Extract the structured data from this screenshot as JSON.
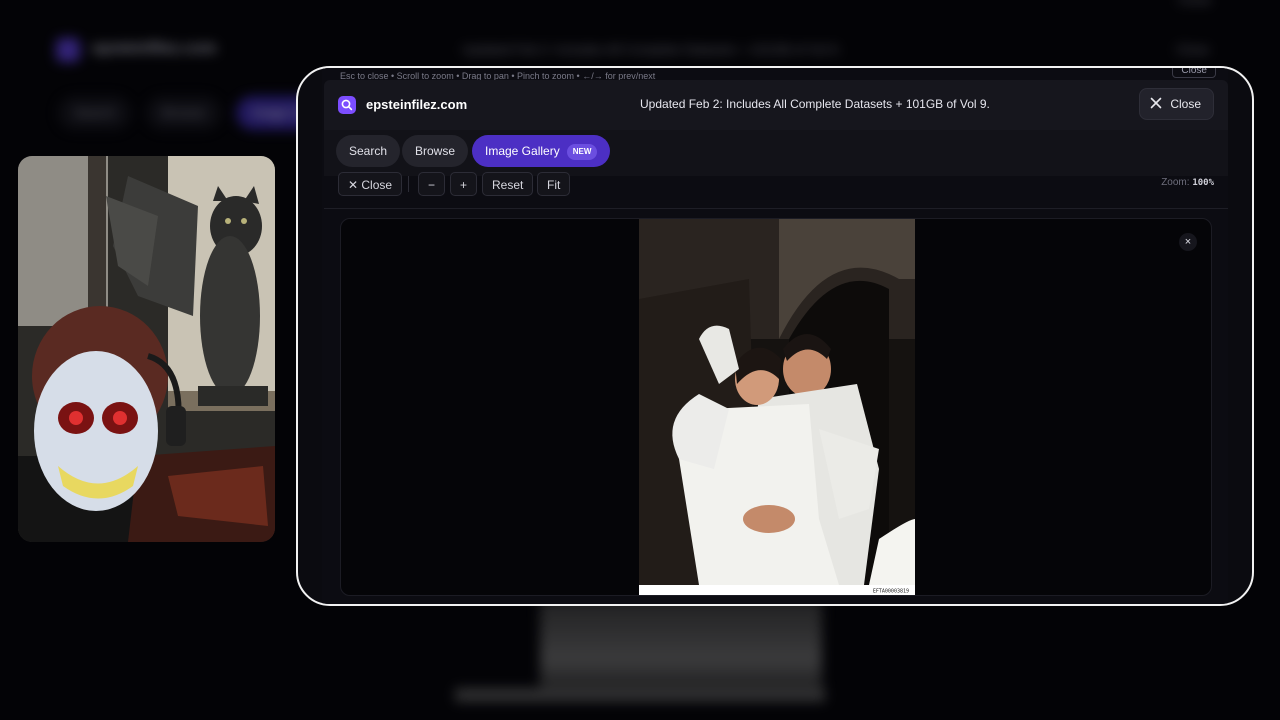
{
  "background": {
    "site_name": "epsteinfilez.com",
    "banner": "Updated Feb 2: Includes All Complete Datasets + 101GB of Vol 9.",
    "close_label": "Close",
    "tabs": [
      "Search",
      "Browse",
      "Image Gallery"
    ]
  },
  "modal": {
    "hint": "Esc to close • Scroll to zoom • Drag to pan • Pinch to zoom • ←/→ for prev/next",
    "hint_close_label": "Close",
    "header": {
      "site_name": "epsteinfilez.com",
      "banner": "Updated Feb 2: Includes All Complete Datasets + 101GB of Vol 9.",
      "close_label": "Close"
    },
    "tabs": [
      {
        "label": "Search",
        "active": false
      },
      {
        "label": "Browse",
        "active": false
      },
      {
        "label": "Image Gallery",
        "active": true,
        "badge": "NEW"
      }
    ],
    "toolbar": {
      "close_label": "✕ Close",
      "zoom_out_label": "−",
      "zoom_in_label": "+",
      "reset_label": "Reset",
      "fit_label": "Fit",
      "zoom_label": "Zoom:",
      "zoom_value": "100%"
    },
    "viewer": {
      "close_glyph": "×",
      "image_caption": "EFTA00003819"
    }
  },
  "colors": {
    "accent": "#4c2fc4",
    "logo": "#7c4dff",
    "frame_border": "#f2f2f2"
  },
  "icons": {
    "logo": "search-icon",
    "close": "close-icon"
  }
}
